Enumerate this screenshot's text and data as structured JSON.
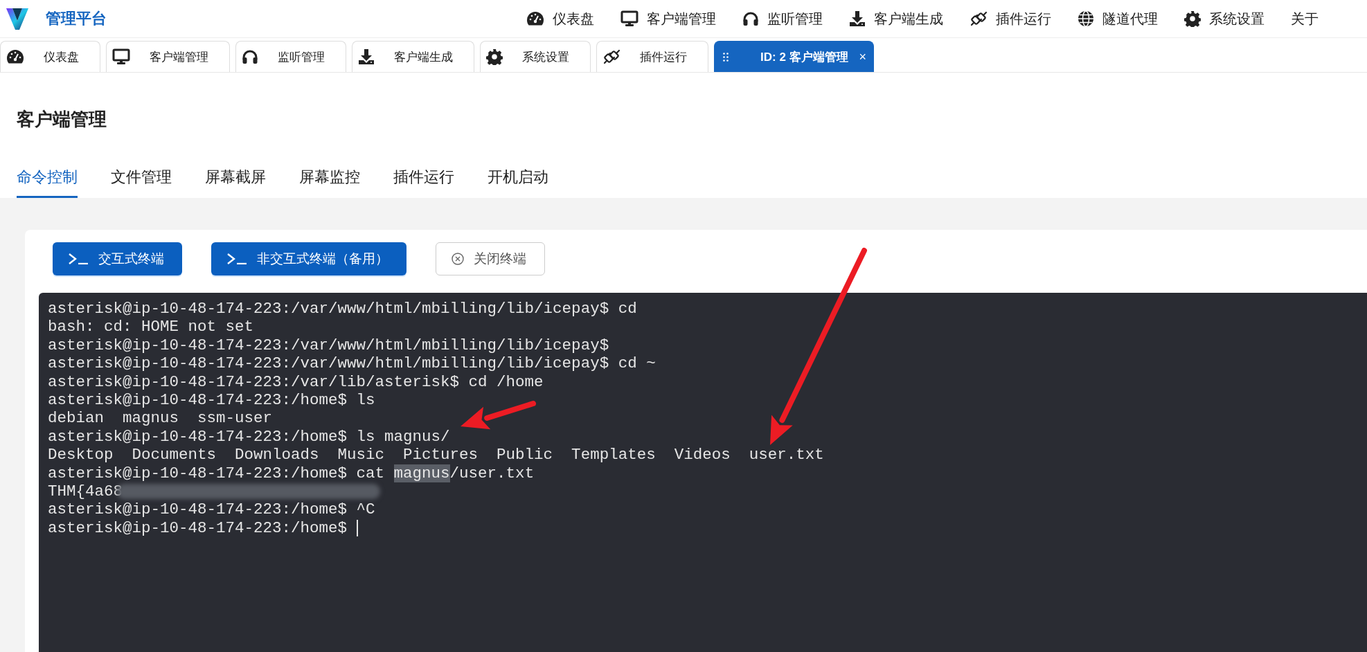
{
  "header": {
    "brand": "管理平台",
    "nav": [
      {
        "label": "仪表盘"
      },
      {
        "label": "客户端管理"
      },
      {
        "label": "监听管理"
      },
      {
        "label": "客户端生成"
      },
      {
        "label": "插件运行"
      },
      {
        "label": "隧道代理"
      },
      {
        "label": "系统设置"
      },
      {
        "label": "关于"
      }
    ]
  },
  "open_tabs": [
    {
      "label": "仪表盘",
      "selected": false
    },
    {
      "label": "客户端管理",
      "selected": false
    },
    {
      "label": "监听管理",
      "selected": false
    },
    {
      "label": "客户端生成",
      "selected": false
    },
    {
      "label": "系统设置",
      "selected": false
    },
    {
      "label": "插件运行",
      "selected": false
    },
    {
      "label": "ID: 2 客户端管理",
      "selected": true,
      "close": "×"
    }
  ],
  "page_title": "客户端管理",
  "sub_tabs": [
    {
      "label": "命令控制",
      "selected": true
    },
    {
      "label": "文件管理",
      "selected": false
    },
    {
      "label": "屏幕截屏",
      "selected": false
    },
    {
      "label": "屏幕监控",
      "selected": false
    },
    {
      "label": "插件运行",
      "selected": false
    },
    {
      "label": "开机启动",
      "selected": false
    }
  ],
  "toolbar": [
    {
      "label": "交互式终端",
      "kind": "primary"
    },
    {
      "label": "非交互式终端（备用）",
      "kind": "primary"
    },
    {
      "label": "关闭终端",
      "kind": "outline"
    }
  ],
  "terminal": {
    "cursor": true,
    "lines": [
      {
        "kind": "plain",
        "text": "asterisk@ip-10-48-174-223:/var/www/html/mbilling/lib/icepay$ cd"
      },
      {
        "kind": "plain",
        "text": "bash: cd: HOME not set"
      },
      {
        "kind": "plain",
        "text": "asterisk@ip-10-48-174-223:/var/www/html/mbilling/lib/icepay$"
      },
      {
        "kind": "plain",
        "text": "asterisk@ip-10-48-174-223:/var/www/html/mbilling/lib/icepay$ cd ~"
      },
      {
        "kind": "plain",
        "text": "asterisk@ip-10-48-174-223:/var/lib/asterisk$ cd /home"
      },
      {
        "kind": "plain",
        "text": "asterisk@ip-10-48-174-223:/home$ ls"
      },
      {
        "kind": "plain",
        "text": "debian  magnus  ssm-user"
      },
      {
        "kind": "plain",
        "text": "asterisk@ip-10-48-174-223:/home$ ls magnus/"
      },
      {
        "kind": "plain",
        "text": "Desktop  Documents  Downloads  Music  Pictures  Public  Templates  Videos  user.txt"
      },
      {
        "kind": "selection",
        "before": "asterisk@ip-10-48-174-223:/home$ cat ",
        "selected": "magnus",
        "after": "/user.txt"
      },
      {
        "kind": "redacted",
        "text": "THM{4a68"
      },
      {
        "kind": "plain",
        "text": "asterisk@ip-10-48-174-223:/home$ ^C"
      },
      {
        "kind": "plain",
        "text": "asterisk@ip-10-48-174-223:/home$ "
      }
    ]
  },
  "annotations": [
    {
      "kind": "arrow"
    },
    {
      "kind": "arrow"
    }
  ]
}
